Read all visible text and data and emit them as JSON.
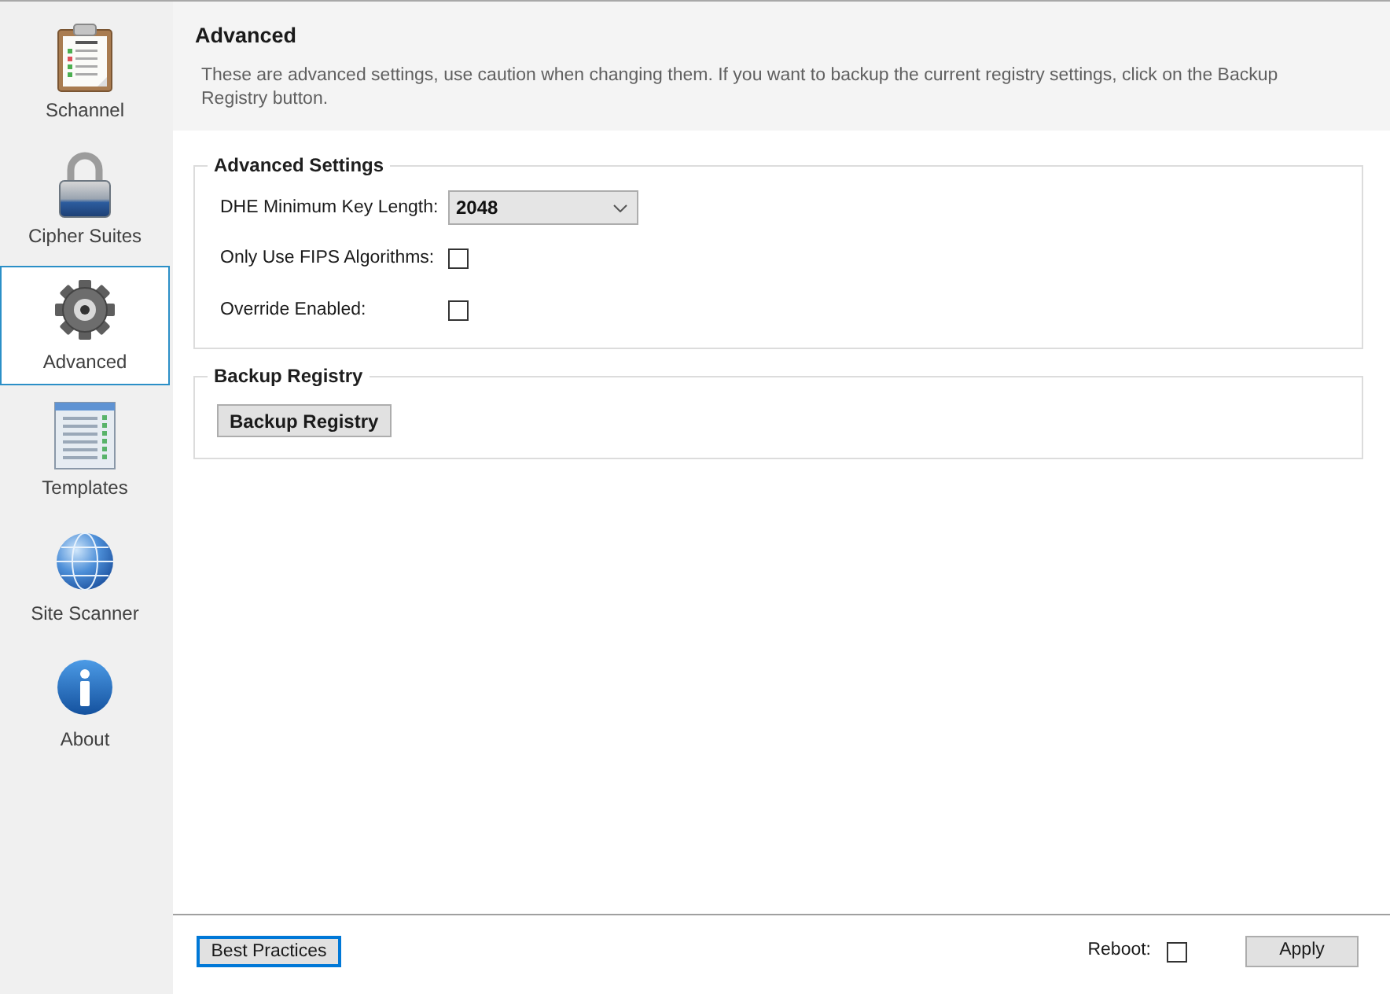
{
  "sidebar": {
    "items": [
      {
        "label": "Schannel",
        "selected": false
      },
      {
        "label": "Cipher Suites",
        "selected": false
      },
      {
        "label": "Advanced",
        "selected": true
      },
      {
        "label": "Templates",
        "selected": false
      },
      {
        "label": "Site Scanner",
        "selected": false
      },
      {
        "label": "About",
        "selected": false
      }
    ]
  },
  "header": {
    "title": "Advanced",
    "description": "These are advanced settings, use caution when changing them. If you want to backup the current registry settings, click on the Backup Registry button."
  },
  "groups": [
    {
      "title": "Advanced Settings",
      "rows": [
        {
          "kind": "dropdown",
          "label": "DHE Minimum Key Length:",
          "value": "2048"
        },
        {
          "kind": "checkbox",
          "label": "Only Use FIPS Algorithms:",
          "checked": false
        },
        {
          "kind": "checkbox",
          "label": "Override Enabled:",
          "checked": false
        }
      ]
    },
    {
      "title": "Backup Registry",
      "buttons": [
        "Backup Registry"
      ]
    }
  ],
  "footer": {
    "best_practices": {
      "label": "Best Practices",
      "focused": true
    },
    "reboot": {
      "label": "Reboot:",
      "checked": false
    },
    "apply": {
      "label": "Apply"
    }
  }
}
